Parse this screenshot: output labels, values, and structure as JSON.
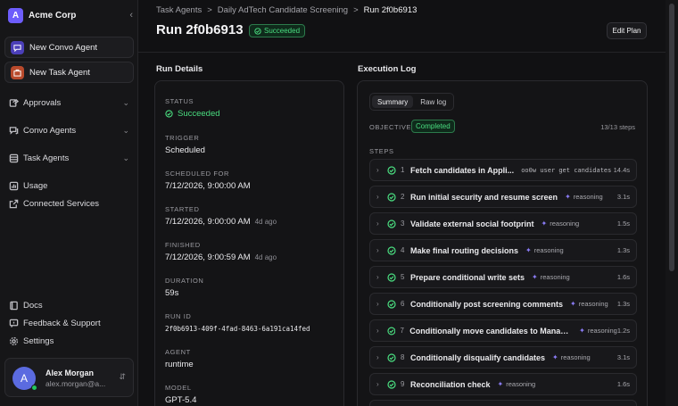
{
  "sidebar": {
    "org_initial": "A",
    "org_name": "Acme Corp",
    "new_convo": "New Convo Agent",
    "new_task": "New Task Agent",
    "nav": {
      "approvals": "Approvals",
      "convo_agents": "Convo Agents",
      "task_agents": "Task Agents",
      "usage": "Usage",
      "connected_services": "Connected Services",
      "docs": "Docs",
      "feedback": "Feedback & Support",
      "settings": "Settings"
    },
    "user": {
      "initial": "A",
      "name": "Alex Morgan",
      "email": "alex.morgan@a..."
    }
  },
  "breadcrumb": {
    "root": "Task Agents",
    "parent": "Daily AdTech Candidate Screening",
    "current": "Run 2f0b6913",
    "sep": ">"
  },
  "header": {
    "title": "Run 2f0b6913",
    "status": "Succeeded",
    "edit_label": "Edit Plan"
  },
  "run_details": {
    "heading": "Run Details",
    "status_label": "STATUS",
    "status_value": "Succeeded",
    "trigger_label": "TRIGGER",
    "trigger_value": "Scheduled",
    "scheduled_label": "SCHEDULED FOR",
    "scheduled_value": "7/12/2026, 9:00:00 AM",
    "started_label": "STARTED",
    "started_value": "7/12/2026, 9:00:00 AM",
    "started_ago": "4d ago",
    "finished_label": "FINISHED",
    "finished_value": "7/12/2026, 9:00:59 AM",
    "finished_ago": "4d ago",
    "duration_label": "DURATION",
    "duration_value": "59s",
    "runid_label": "RUN ID",
    "runid_value": "2f0b6913-409f-4fad-8463-6a191ca14fed",
    "agent_label": "AGENT",
    "agent_value": "runtime",
    "model_label": "MODEL",
    "model_value": "GPT-5.4"
  },
  "execution_log": {
    "heading": "Execution Log",
    "tabs": [
      "Summary",
      "Raw log"
    ],
    "objective_label": "OBJECTIVE",
    "objective_status": "Completed",
    "step_count": "13/13 steps",
    "steps_label": "STEPS",
    "steps": [
      {
        "num": "1",
        "name": "Fetch candidates in Appli...",
        "tag": "oo0w user get candidates",
        "dur": "14.4s"
      },
      {
        "num": "2",
        "name": "Run initial security and resume screen",
        "tag": "reasoning",
        "dur": "3.1s"
      },
      {
        "num": "3",
        "name": "Validate external social footprint",
        "tag": "reasoning",
        "dur": "1.5s"
      },
      {
        "num": "4",
        "name": "Make final routing decisions",
        "tag": "reasoning",
        "dur": "1.3s"
      },
      {
        "num": "5",
        "name": "Prepare conditional write sets",
        "tag": "reasoning",
        "dur": "1.6s"
      },
      {
        "num": "6",
        "name": "Conditionally post screening comments",
        "tag": "reasoning",
        "dur": "1.3s"
      },
      {
        "num": "7",
        "name": "Conditionally move candidates to Manage...",
        "tag": "reasoning",
        "dur": "1.2s"
      },
      {
        "num": "8",
        "name": "Conditionally disqualify candidates",
        "tag": "reasoning",
        "dur": "3.1s"
      },
      {
        "num": "9",
        "name": "Reconciliation check",
        "tag": "reasoning",
        "dur": "1.6s"
      },
      {
        "num": "10",
        "name": "Conditionally mark candidates...",
        "tag": "reasoning",
        "dur": "2.5s"
      }
    ]
  },
  "colors": {
    "accent": "#6d5dfc",
    "success": "#4ade80",
    "background": "#111113"
  },
  "icons": [
    "chevron-left-icon",
    "chat-icon",
    "briefcase-icon",
    "approvals-icon",
    "chevron-down-icon",
    "list-icon",
    "usage-icon",
    "external-link-icon",
    "book-icon",
    "feedback-icon",
    "gear-icon",
    "check-circle-icon",
    "sparkle-icon",
    "chevron-right-icon",
    "updown-icon"
  ]
}
